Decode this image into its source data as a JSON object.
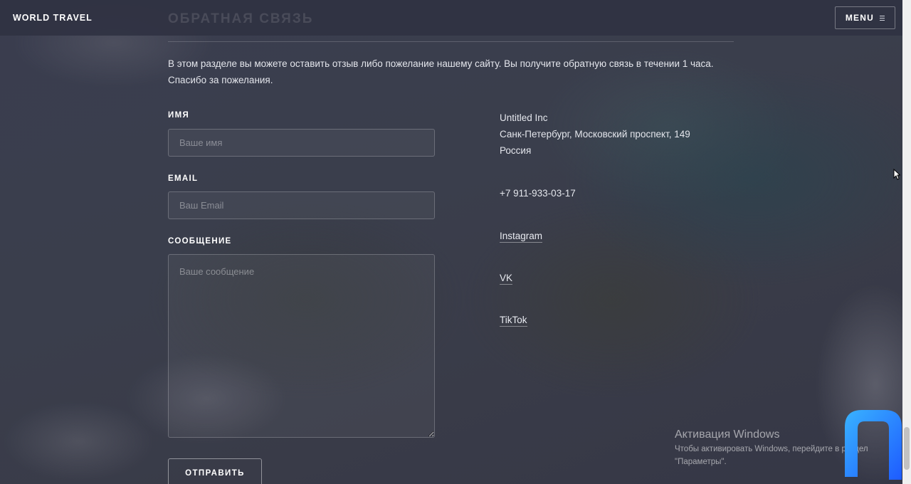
{
  "header": {
    "brand": "WORLD TRAVEL",
    "menu_label": "MENU"
  },
  "section": {
    "title": "ОБРАТНАЯ СВЯЗЬ",
    "intro_line1": "В этом разделе вы можете оставить отзыв либо пожелание нашему сайту. Вы получите обратную связь в течении 1 часа.",
    "intro_line2": "Спасибо за пожелания."
  },
  "form": {
    "name_label": "ИМЯ",
    "name_placeholder": "Ваше имя",
    "email_label": "EMAIL",
    "email_placeholder": "Ваш Email",
    "message_label": "СООБЩЕНИЕ",
    "message_placeholder": "Ваше сообщение",
    "submit_label": "ОТПРАВИТЬ"
  },
  "contact": {
    "company": "Untitled Inc",
    "address": "Санк-Петербург, Московский проспект, 149",
    "country": "Россия",
    "phone": "+7 911-933-03-17",
    "links": [
      "Instagram",
      "VK",
      "TikTok"
    ]
  },
  "windows_activation": {
    "title": "Активация Windows",
    "line1": "Чтобы активировать Windows, перейдите в раздел",
    "line2": "\"Параметры\"."
  },
  "colors": {
    "overlay": "#383a4c",
    "text": "#e4e6ec",
    "logo_blue": "#2d7bff"
  }
}
